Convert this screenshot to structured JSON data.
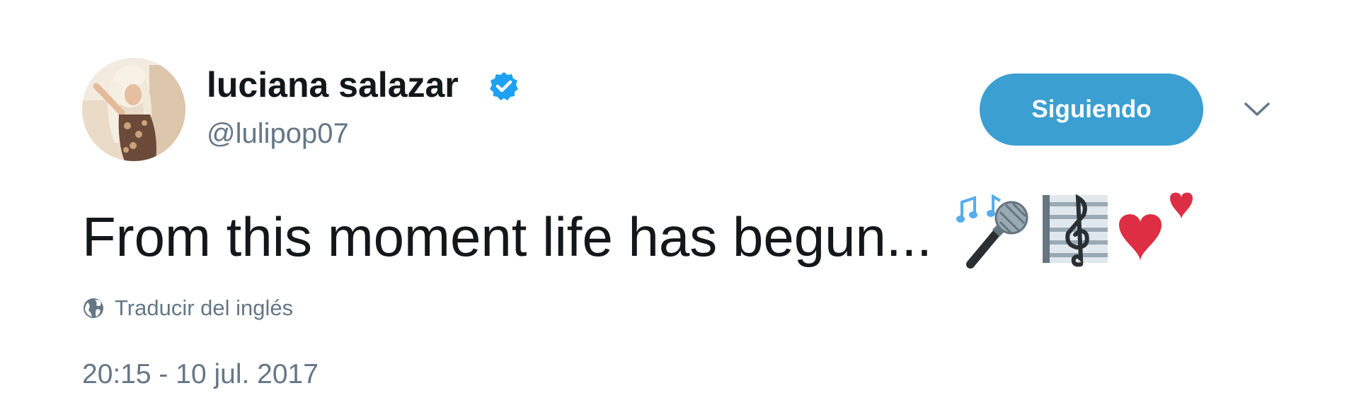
{
  "user": {
    "display_name": "luciana salazar",
    "handle": "@lulipop07",
    "verified": true
  },
  "follow_button": {
    "label": "Siguiendo"
  },
  "tweet": {
    "text": "From this moment life has begun...",
    "emojis": [
      "musical-notes",
      "microphone",
      "musical-score",
      "two-hearts"
    ]
  },
  "translate": {
    "label": "Traducir del inglés"
  },
  "timestamp": "20:15 - 10 jul. 2017",
  "colors": {
    "accent": "#3b9fd1",
    "secondary_text": "#657786",
    "primary_text": "#14171a",
    "verified": "#1da1f2"
  }
}
